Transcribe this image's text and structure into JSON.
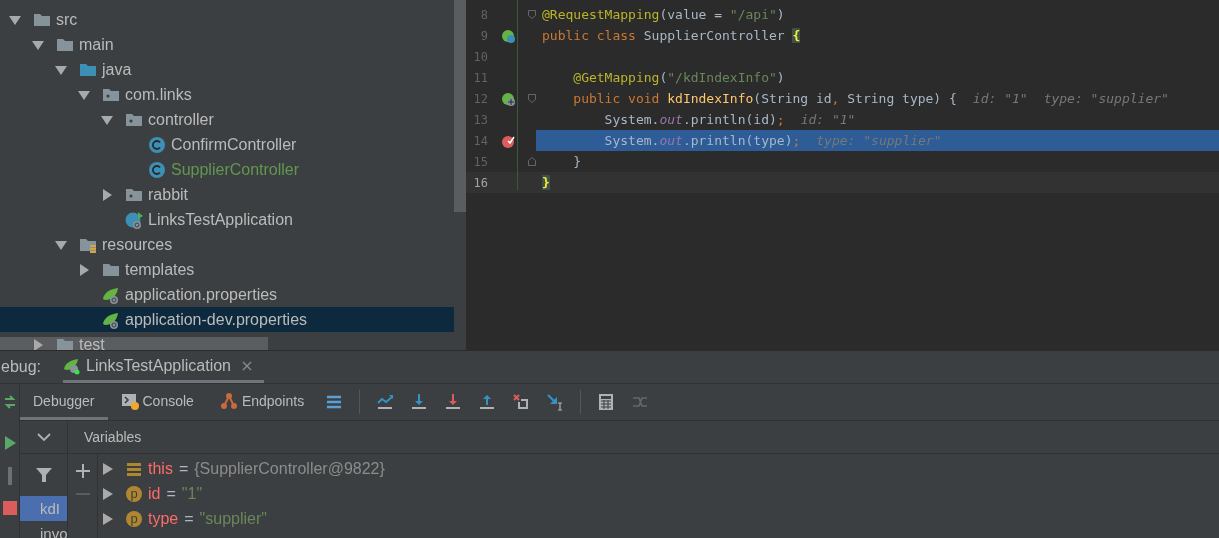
{
  "project_tree": {
    "items": [
      {
        "label": "src",
        "kind": "folder",
        "expanded": true,
        "selected": false,
        "added": false,
        "children": [
          {
            "label": "main",
            "kind": "folder",
            "expanded": true,
            "selected": false,
            "added": false,
            "children": [
              {
                "label": "java",
                "kind": "source-folder",
                "expanded": true,
                "selected": false,
                "added": false,
                "children": [
                  {
                    "label": "com.links",
                    "kind": "package",
                    "expanded": true,
                    "selected": false,
                    "added": false,
                    "children": [
                      {
                        "label": "controller",
                        "kind": "package",
                        "expanded": true,
                        "selected": false,
                        "added": false,
                        "children": [
                          {
                            "label": "ConfirmController",
                            "kind": "class",
                            "selected": false,
                            "added": false
                          },
                          {
                            "label": "SupplierController",
                            "kind": "class",
                            "selected": false,
                            "added": true
                          }
                        ]
                      },
                      {
                        "label": "rabbit",
                        "kind": "package",
                        "expanded": false,
                        "selected": false,
                        "added": false
                      },
                      {
                        "label": "LinksTestApplication",
                        "kind": "app",
                        "selected": false,
                        "added": false
                      }
                    ]
                  }
                ]
              },
              {
                "label": "resources",
                "kind": "resource-folder",
                "expanded": true,
                "selected": false,
                "added": false,
                "children": [
                  {
                    "label": "templates",
                    "kind": "folder",
                    "expanded": false,
                    "selected": false,
                    "added": false
                  },
                  {
                    "label": "application.properties",
                    "kind": "properties",
                    "selected": false,
                    "added": false
                  },
                  {
                    "label": "application-dev.properties",
                    "kind": "properties",
                    "selected": true,
                    "added": false
                  }
                ]
              }
            ]
          },
          {
            "label": "test",
            "kind": "folder",
            "expanded": false,
            "selected": false,
            "added": false
          }
        ]
      }
    ]
  },
  "editor": {
    "lines": [
      {
        "number": "8",
        "fold": {
          "kind": "start"
        },
        "highlighted": false,
        "current": false,
        "tokens": [
          {
            "kind": "ann",
            "text": "@RequestMapping"
          },
          {
            "kind": "plain",
            "text": "(value = "
          },
          {
            "kind": "str",
            "text": "\"/api\""
          },
          {
            "kind": "plain",
            "text": ")"
          }
        ]
      },
      {
        "number": "9",
        "gutter": {
          "kind": "bean"
        },
        "highlighted": false,
        "current": false,
        "tokens": [
          {
            "kind": "kw",
            "text": "public class "
          },
          {
            "kind": "plain",
            "text": "SupplierController "
          },
          {
            "kind": "brace",
            "text": "{"
          }
        ]
      },
      {
        "number": "10",
        "highlighted": false,
        "current": false
      },
      {
        "number": "11",
        "highlighted": false,
        "current": false,
        "tokens": [
          {
            "kind": "ann",
            "text": "    @GetMapping"
          },
          {
            "kind": "plain",
            "text": "("
          },
          {
            "kind": "str",
            "text": "\"/kdIndexInfo\""
          },
          {
            "kind": "plain",
            "text": ")"
          }
        ]
      },
      {
        "number": "12",
        "gutter": {
          "kind": "mapping"
        },
        "fold": {
          "kind": "start"
        },
        "highlighted": false,
        "current": false,
        "tokens": [
          {
            "kind": "kw",
            "text": "    public void "
          },
          {
            "kind": "method",
            "text": "kdIndexInfo"
          },
          {
            "kind": "plain",
            "text": "(String id"
          },
          {
            "kind": "kw",
            "text": ", "
          },
          {
            "kind": "plain",
            "text": "String type) {"
          },
          {
            "kind": "hint",
            "text": "id: \"1\""
          },
          {
            "kind": "hint",
            "text": "type: \"supplier\""
          }
        ]
      },
      {
        "number": "13",
        "highlighted": false,
        "current": false,
        "tokens": [
          {
            "kind": "plain",
            "text": "        System."
          },
          {
            "kind": "field",
            "text": "out"
          },
          {
            "kind": "plain",
            "text": ".println(id)"
          },
          {
            "kind": "kw",
            "text": ";"
          },
          {
            "kind": "hint",
            "text": "id: \"1\""
          }
        ]
      },
      {
        "number": "14",
        "gutter": {
          "kind": "breakpoint"
        },
        "highlighted": true,
        "current": false,
        "tokens": [
          {
            "kind": "plain",
            "text": "        System."
          },
          {
            "kind": "field",
            "text": "out"
          },
          {
            "kind": "plain",
            "text": ".println(type)"
          },
          {
            "kind": "kw",
            "text": ";"
          },
          {
            "kind": "hint",
            "text": "type: \"supplier\""
          }
        ]
      },
      {
        "number": "15",
        "fold": {
          "kind": "end"
        },
        "highlighted": false,
        "current": false,
        "tokens": [
          {
            "kind": "plain",
            "text": "    }"
          }
        ]
      },
      {
        "number": "16",
        "highlighted": false,
        "current": true,
        "tokens": [
          {
            "kind": "brace",
            "text": "}"
          }
        ]
      }
    ]
  },
  "debug": {
    "title": "ebug:",
    "sessions": [
      {
        "label": "LinksTestApplication",
        "selected": true
      }
    ],
    "tabs": [
      {
        "label": "Debugger",
        "kind": "debugger",
        "selected": true
      },
      {
        "label": "Console",
        "kind": "console",
        "selected": false
      },
      {
        "label": "Endpoints",
        "kind": "endpoints",
        "selected": false
      }
    ],
    "action_groups": [
      [
        {
          "kind": "layout",
          "disabled": false
        }
      ],
      [
        {
          "kind": "step-over",
          "disabled": false
        },
        {
          "kind": "step-into",
          "disabled": false
        },
        {
          "kind": "force-step-into",
          "disabled": false
        },
        {
          "kind": "step-out",
          "disabled": false
        },
        {
          "kind": "drop-frame",
          "disabled": false
        },
        {
          "kind": "run-to-cursor",
          "disabled": false
        }
      ],
      [
        {
          "kind": "evaluate",
          "disabled": false
        },
        {
          "kind": "trace",
          "disabled": true
        }
      ]
    ],
    "frames": [
      {
        "label": "kdI",
        "selected": true
      },
      {
        "label": "invo",
        "selected": false
      }
    ],
    "variables_title": "Variables",
    "variables": [
      {
        "kind": "field",
        "name": "this",
        "equals": "=",
        "value": {
          "kind": "object",
          "text": "{SupplierController@9822}"
        }
      },
      {
        "kind": "param",
        "badge": "p",
        "name": "id",
        "equals": "=",
        "value": {
          "kind": "string",
          "text": "\"1\""
        }
      },
      {
        "kind": "param",
        "badge": "p",
        "name": "type",
        "equals": "=",
        "value": {
          "kind": "string",
          "text": "\"supplier\""
        }
      }
    ]
  }
}
